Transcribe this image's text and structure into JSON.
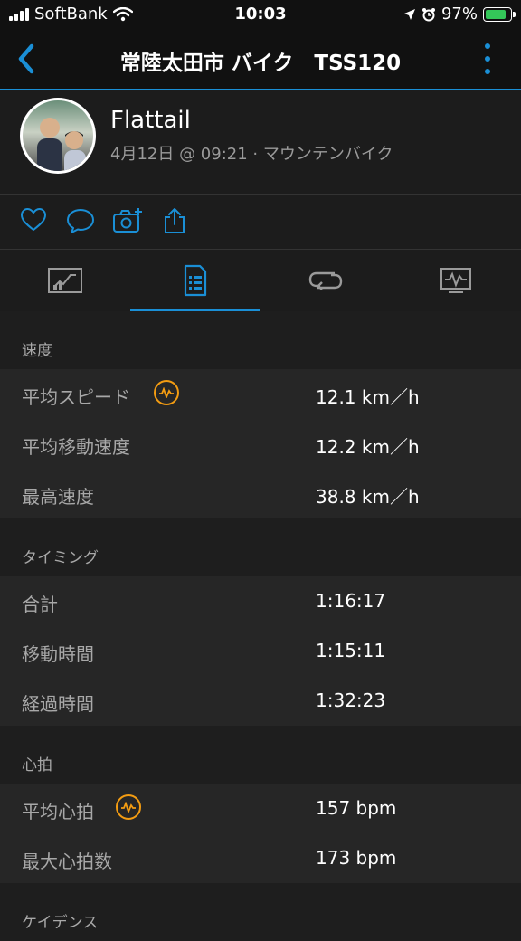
{
  "status_bar": {
    "carrier": "SoftBank",
    "time": "10:03",
    "battery": "97%"
  },
  "header": {
    "title": "常陸太田市 バイク　TSS120"
  },
  "profile": {
    "name": "Flattail",
    "meta": "4月12日 @ 09:21 · マウンテンバイク"
  },
  "sections": [
    {
      "title": "速度",
      "rows": [
        {
          "label": "平均スピード",
          "value": "12.1 km／h",
          "badge": true
        },
        {
          "label": "平均移動速度",
          "value": "12.2 km／h"
        },
        {
          "label": "最高速度",
          "value": "38.8 km／h"
        }
      ]
    },
    {
      "title": "タイミング",
      "rows": [
        {
          "label": "合計",
          "value": "1:16:17"
        },
        {
          "label": "移動時間",
          "value": "1:15:11"
        },
        {
          "label": "経過時間",
          "value": "1:32:23"
        }
      ]
    },
    {
      "title": "心拍",
      "rows": [
        {
          "label": "平均心拍",
          "value": "157 bpm",
          "badge": true
        },
        {
          "label": "最大心拍数",
          "value": "173 bpm"
        }
      ]
    },
    {
      "title": "ケイデンス",
      "rows": []
    }
  ],
  "colors": {
    "accent": "#1a8fd6",
    "badge": "#f39c12",
    "battery": "#34c759"
  }
}
